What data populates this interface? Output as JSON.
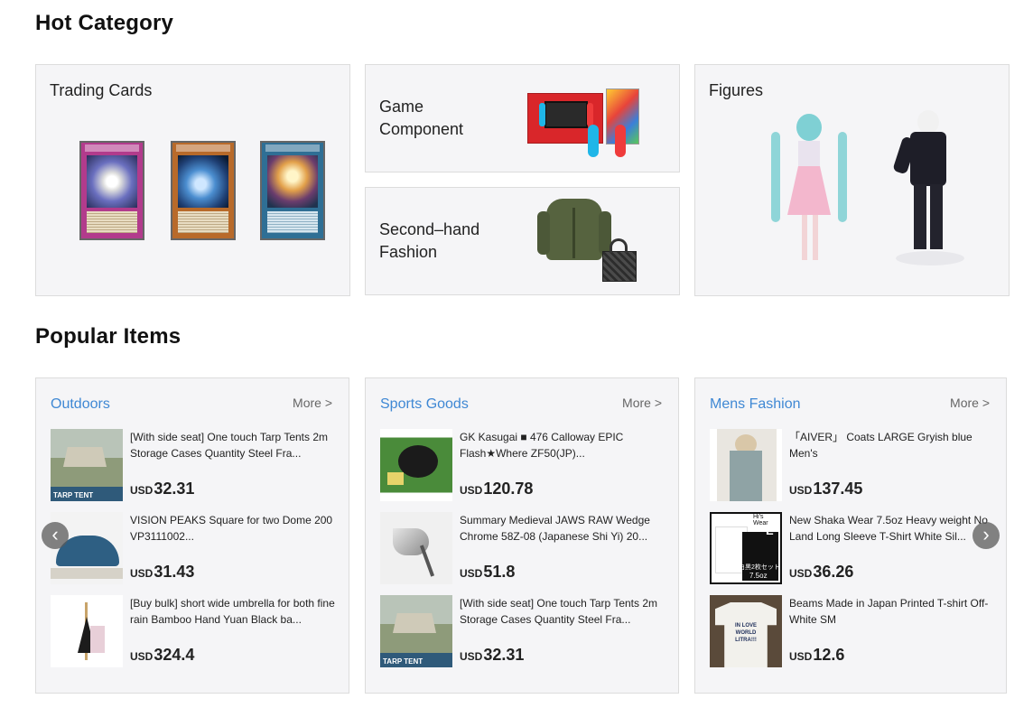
{
  "hot_category": {
    "title": "Hot Category",
    "cards": {
      "trading_cards": {
        "label": "Trading Cards"
      },
      "game_component": {
        "label": "Game\nComponent"
      },
      "second_hand_fashion": {
        "label": "Second–hand\nFashion"
      },
      "figures": {
        "label": "Figures"
      }
    }
  },
  "popular_items": {
    "title": "Popular Items",
    "more_label": "More >",
    "sections": [
      {
        "name": "Outdoors",
        "items": [
          {
            "title": "[With side seat] One touch Tarp Tents 2m Storage Cases Quantity Steel Fra...",
            "currency": "USD",
            "price": "32.31"
          },
          {
            "title": "VISION PEAKS Square for two Dome 200 VP3111002...",
            "currency": "USD",
            "price": "31.43"
          },
          {
            "title": "[Buy bulk] short wide umbrella for both fine rain Bamboo Hand Yuan Black ba...",
            "currency": "USD",
            "price": "324.4"
          }
        ]
      },
      {
        "name": "Sports Goods",
        "items": [
          {
            "title": "GK Kasugai ■ 476 Calloway EPIC Flash★Where ZF50(JP)...",
            "currency": "USD",
            "price": "120.78"
          },
          {
            "title": "Summary Medieval JAWS RAW Wedge Chrome 58Z-08 (Japanese Shi Yi) 20...",
            "currency": "USD",
            "price": "51.8"
          },
          {
            "title": "[With side seat] One touch Tarp Tents 2m Storage Cases Quantity Steel Fra...",
            "currency": "USD",
            "price": "32.31"
          }
        ]
      },
      {
        "name": "Mens Fashion",
        "items": [
          {
            "title": "「AIVER」 Coats LARGE Gryish blue Men's",
            "currency": "USD",
            "price": "137.45"
          },
          {
            "title": "New Shaka Wear 7.5oz Heavy weight No Land Long Sleeve T-Shirt White Sil...",
            "currency": "USD",
            "price": "36.26"
          },
          {
            "title": "Beams Made in Japan Printed T-shirt Off-White SM",
            "currency": "USD",
            "price": "12.6"
          }
        ]
      }
    ]
  },
  "thumb_text": {
    "tent_caption": "TARP TENT",
    "tee_badge": "L",
    "tee_brand": "Hi's Wear",
    "tee_set": "白黒2枚セット",
    "tee_oz": "7.5oz",
    "beams_print": "IN LOVE WORLD LITRA!!!"
  },
  "carousel": {
    "prev_icon": "‹",
    "next_icon": "›"
  }
}
